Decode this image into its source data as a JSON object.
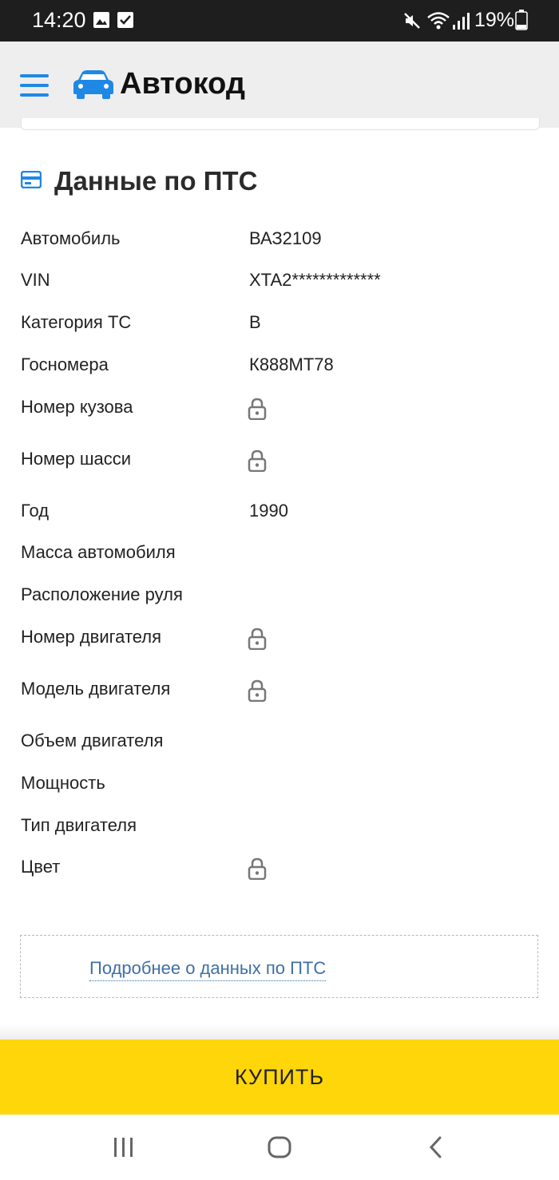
{
  "status_bar": {
    "time": "14:20",
    "battery": "19%",
    "icons": [
      "image-icon",
      "checkbox-icon",
      "mute-icon",
      "wifi-icon",
      "signal-icon",
      "battery-icon"
    ]
  },
  "header": {
    "app_title": "Автокод",
    "menu_icon": "hamburger-menu-icon",
    "logo_icon": "car-icon",
    "accent_color": "#1e88e5"
  },
  "pts_section": {
    "title": "Данные по ПТС",
    "icon": "card-icon",
    "rows": [
      {
        "label": "Автомобиль",
        "value": "ВАЗ2109",
        "locked": false
      },
      {
        "label": "VIN",
        "value": "XTA2*************",
        "locked": false
      },
      {
        "label": "Категория ТС",
        "value": "B",
        "locked": false
      },
      {
        "label": "Госномера",
        "value": "К888МТ78",
        "locked": false
      },
      {
        "label": "Номер кузова",
        "value": "",
        "locked": true
      },
      {
        "label": "Номер шасси",
        "value": "",
        "locked": true
      },
      {
        "label": "Год",
        "value": "1990",
        "locked": false
      },
      {
        "label": "Масса автомобиля",
        "value": "",
        "locked": false
      },
      {
        "label": "Расположение руля",
        "value": "",
        "locked": false
      },
      {
        "label": "Номер двигателя",
        "value": "",
        "locked": true
      },
      {
        "label": "Модель двигателя",
        "value": "",
        "locked": true
      },
      {
        "label": "Объем двигателя",
        "value": "",
        "locked": false
      },
      {
        "label": "Мощность",
        "value": "",
        "locked": false
      },
      {
        "label": "Тип двигателя",
        "value": "",
        "locked": false
      },
      {
        "label": "Цвет",
        "value": "",
        "locked": true
      }
    ],
    "more_link": "Подробнее о данных по ПТС"
  },
  "buy_button": {
    "label": "КУПИТЬ",
    "color": "#ffd60a"
  },
  "nav_bar": {
    "buttons": [
      "recents-icon",
      "home-icon",
      "back-icon"
    ]
  }
}
